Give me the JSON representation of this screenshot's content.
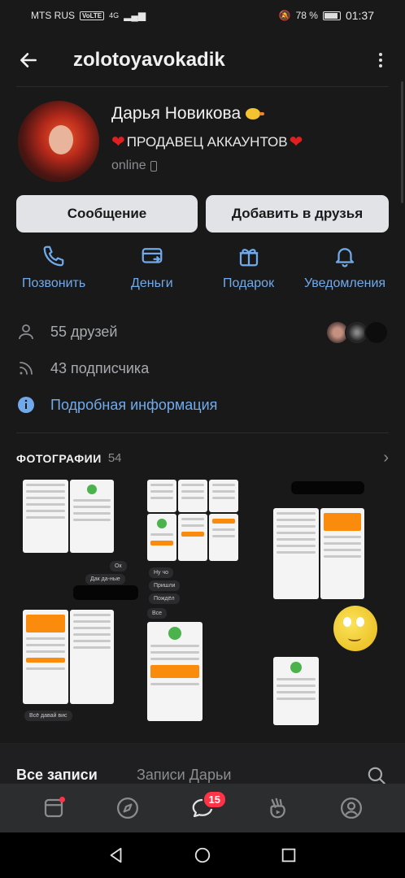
{
  "status_bar": {
    "carrier": "MTS RUS",
    "volte": "VoLTE",
    "network": "4G",
    "battery": "78 %",
    "time": "01:37"
  },
  "header": {
    "title": "zolotoyavokadik"
  },
  "profile": {
    "name": "Дарья Новикова",
    "status_text": "ПРОДАВЕЦ АККАУНТОВ",
    "online": "online"
  },
  "buttons": {
    "message": "Сообщение",
    "add_friend": "Добавить в друзья"
  },
  "actions": [
    {
      "label": "Позвонить",
      "icon": "phone-icon"
    },
    {
      "label": "Деньги",
      "icon": "money-transfer-icon"
    },
    {
      "label": "Подарок",
      "icon": "gift-icon"
    },
    {
      "label": "Уведомления",
      "icon": "bell-icon"
    }
  ],
  "info": {
    "friends": "55 друзей",
    "followers": "43 подписчика",
    "details": "Подробная информация"
  },
  "photos": {
    "title": "ФОТОГРАФИИ",
    "count": "54",
    "chat_snippets": [
      "Ок",
      "Дак да-ные",
      "Ну чо",
      "Пришли",
      "Пождёл",
      "Все",
      "Всё давай вис"
    ]
  },
  "tabs": {
    "all": "Все записи",
    "dasha": "Записи Дарьи"
  },
  "bottom_nav": {
    "messages_badge": "15"
  },
  "colors": {
    "accent": "#71aaeb",
    "background": "#19191a",
    "badge": "#ff3347"
  }
}
